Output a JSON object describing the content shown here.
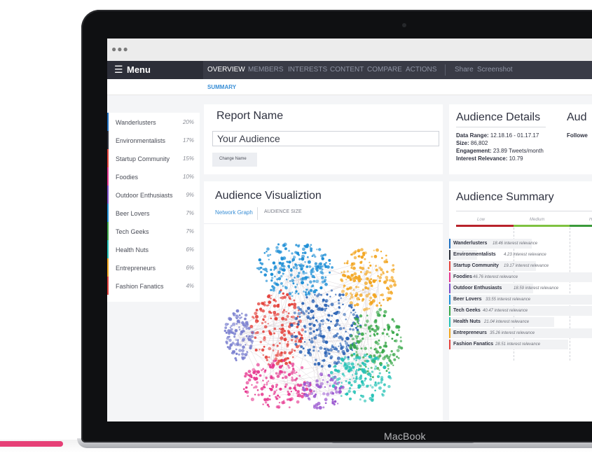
{
  "device": {
    "brand": "MacBook"
  },
  "window": {
    "dots": "●●●"
  },
  "menu": {
    "glyph": "☰",
    "label": "Menu"
  },
  "nav": {
    "tabs": [
      {
        "label": "OVERVIEW",
        "active": true
      },
      {
        "label": "MEMBERS"
      },
      {
        "label": "INTERESTS"
      },
      {
        "label": "CONTENT"
      },
      {
        "label": "COMPARE"
      },
      {
        "label": "ACTIONS"
      }
    ],
    "share": "Share",
    "screenshot": "Screenshot"
  },
  "subnav": {
    "summary": "SUMMARY"
  },
  "sidebar": {
    "items": [
      {
        "label": "Wanderlusters",
        "pct": "20%",
        "color": "#1f6fbf"
      },
      {
        "label": "Environmentalists",
        "pct": "17%",
        "color": "#2b2f3a"
      },
      {
        "label": "Startup Community",
        "pct": "15%",
        "color": "#e4433d"
      },
      {
        "label": "Foodies",
        "pct": "10%",
        "color": "#e6368f"
      },
      {
        "label": "Outdoor Enthusiasts",
        "pct": "9%",
        "color": "#7e4fc7"
      },
      {
        "label": "Beer Lovers",
        "pct": "7%",
        "color": "#1f8fd6"
      },
      {
        "label": "Tech Geeks",
        "pct": "7%",
        "color": "#39a84a"
      },
      {
        "label": "Health Nuts",
        "pct": "6%",
        "color": "#25c2b6"
      },
      {
        "label": "Entrepreneurs",
        "pct": "6%",
        "color": "#f2a51f"
      },
      {
        "label": "Fashion Fanatics",
        "pct": "4%",
        "color": "#e4433d"
      }
    ]
  },
  "report": {
    "title": "Report Name",
    "input_value": "Your Audience",
    "change_button": "Change Name"
  },
  "details": {
    "title": "Audience Details",
    "date_label": "Data Range:",
    "date_value": "12.18.16 - 01.17.17",
    "size_label": "Size:",
    "size_value": "86,802",
    "engagement_label": "Engagement:",
    "engagement_value": "23.89 Tweets/month",
    "relevance_label": "Interest Relevance:",
    "relevance_value": "10.79"
  },
  "extra_card": {
    "title": "Aud",
    "label": "Followe"
  },
  "visualization": {
    "title": "Audience Visualiztion",
    "tab_graph": "Network Graph",
    "tab_size": "AUDIENCE SIZE",
    "cluster_colors": [
      "#1f8fd6",
      "#f2a51f",
      "#7a7fcf",
      "#e4433d",
      "#e6368f",
      "#2b63b5",
      "#39a84a",
      "#25c2b6",
      "#9b59d0"
    ]
  },
  "summary": {
    "title": "Audience Summary",
    "scale": {
      "low": "Low",
      "medium": "Medium",
      "high": "H"
    },
    "scale_colors": {
      "low": "#b8232b",
      "medium": "#7fc241",
      "high": "#3a9a3a"
    },
    "rows": [
      {
        "name": "Wanderlusters",
        "value": "18.46 interest relevance",
        "color": "#1f6fbf"
      },
      {
        "name": "Environmentalists",
        "value": "4.23 interest relevance",
        "color": "#2b2f3a"
      },
      {
        "name": "Startup Community",
        "value": "19.17 interest relevance",
        "color": "#e4433d"
      },
      {
        "name": "Foodies",
        "value": "46.76 interest relevance",
        "color": "#e6368f"
      },
      {
        "name": "Outdoor Enthusiasts",
        "value": "18.59 interest relevance",
        "color": "#7e4fc7"
      },
      {
        "name": "Beer Lovers",
        "value": "33.55 interest relevance",
        "color": "#1f8fd6"
      },
      {
        "name": "Tech Geeks",
        "value": "40.47 interest relevance",
        "color": "#39a84a"
      },
      {
        "name": "Health Nuts",
        "value": "21.04 interest relevance",
        "color": "#25c2b6"
      },
      {
        "name": "Entrepreneurs",
        "value": "35.26 interest relevance",
        "color": "#f2a51f"
      },
      {
        "name": "Fashion Fanatics",
        "value": "28.51 interest relevance",
        "color": "#e4433d"
      }
    ]
  }
}
